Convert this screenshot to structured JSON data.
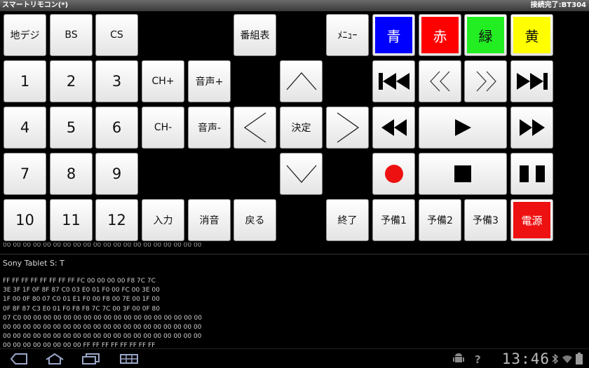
{
  "titlebar": {
    "app_title": "スマートリモコン(*)",
    "status": "接続完了:BT304"
  },
  "buttons": {
    "terrestrial": "地デジ",
    "bs": "BS",
    "cs": "CS",
    "program_guide": "番組表",
    "menu": "ﾒﾆｭｰ",
    "blue": "青",
    "red": "赤",
    "green": "緑",
    "yellow": "黄",
    "ch_up": "CH+",
    "vol_up": "音声+",
    "ch_down": "CH-",
    "vol_down": "音声-",
    "enter": "決定",
    "input": "入力",
    "mute": "消音",
    "back": "戻る",
    "quit": "終了",
    "spare1": "予備1",
    "spare2": "予備2",
    "spare3": "予備3",
    "power": "電源",
    "n1": "1",
    "n2": "2",
    "n3": "3",
    "n4": "4",
    "n5": "5",
    "n6": "6",
    "n7": "7",
    "n8": "8",
    "n9": "9",
    "n10": "10",
    "n11": "11",
    "n12": "12"
  },
  "colors": {
    "blue": "#0000ff",
    "red": "#ff0000",
    "green": "#22ee22",
    "yellow": "#ffff00",
    "power": "#ee1111",
    "record": "#ee1111"
  },
  "log": {
    "cut_line": "00 00 00 00 00 00 00 00 00 00 00 00 00 00 00 00 00 00 00 00",
    "device": "Sony Tablet S:  T",
    "hex_lines": [
      "FF FF FF FF FF FF FF FF FC 00 00 00 00 F8 7C 7C",
      "3E 3F 1F 0F 8F 87 C0 03 E0 01 F0 00 FC 00 3E 00",
      "1F 00 0F 80 07 C0 01 E1 F0 00 F8 00 7E 00 1F 00",
      "0F 8F 87 C3 E0 01 F0 F8 F8 7C 7C 00 3F 00 0F 80",
      "07 C0 00 00 00 00 00 00 00 00 00 00 00 00 00 00 00 00 00 00",
      "00 00 00 00 00 00 00 00 00 00 00 00 00 00 00 00 00 00 00 00",
      "00 00 00 00 00 00 00 00 00 00 00 00 00 00 00 00 00 00 00 00",
      "00 00 00 00 00 00 00 00 FF FF FF FF FF FF FF FF"
    ]
  },
  "navbar": {
    "clock": "13:46"
  }
}
